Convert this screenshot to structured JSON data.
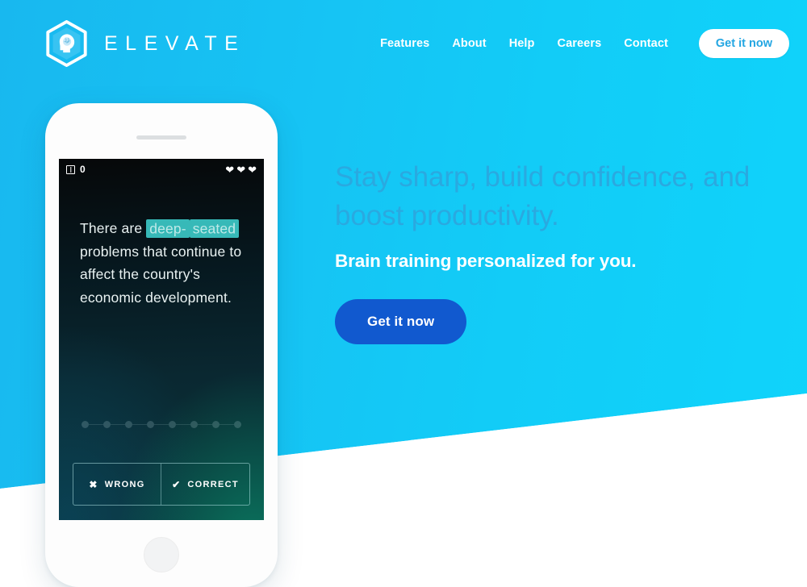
{
  "brand": {
    "name": "ELEVATE",
    "logo_icon": "hexagon-brain-head-icon"
  },
  "nav": {
    "links": [
      {
        "label": "Features"
      },
      {
        "label": "About"
      },
      {
        "label": "Help"
      },
      {
        "label": "Careers"
      },
      {
        "label": "Contact"
      }
    ],
    "cta_label": "Get it now"
  },
  "hero": {
    "headline": "Stay sharp, build confidence, and boost productivity.",
    "subhead": "Brain training personalized for you.",
    "cta_label": "Get it now"
  },
  "phone": {
    "screen": {
      "topbar": {
        "coin_icon": "coin-icon",
        "coin_count": "0",
        "lives_icon": "heart-icon",
        "lives_count": 3
      },
      "quiz": {
        "text_before": "There are ",
        "highlight_1": "deep-",
        "highlight_2": "seated",
        "text_after": " problems that continue to affect the country's economic development."
      },
      "progress": {
        "dot_count": 8
      },
      "answers": [
        {
          "label": "WRONG",
          "glyph": "✖",
          "icon": "cross-icon"
        },
        {
          "label": "CORRECT",
          "glyph": "✔",
          "icon": "check-icon"
        }
      ]
    }
  },
  "colors": {
    "bg_gradient_start": "#18b8ef",
    "bg_gradient_end": "#0fd4fb",
    "headline": "#2aa9e0",
    "cta_primary": "#1159cf",
    "nav_cta_text": "#23a6e2",
    "highlight": "#37b9b8",
    "wedge": "#ffffff"
  }
}
